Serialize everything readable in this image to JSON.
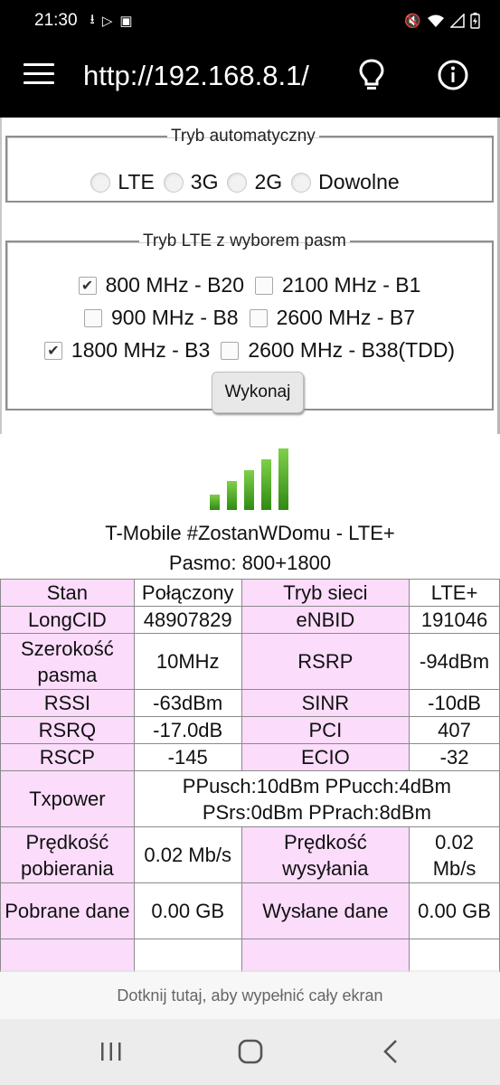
{
  "status_bar": {
    "time": "21:30",
    "left_icons": [
      "download-icon",
      "play-store-icon",
      "image-icon"
    ],
    "right_icons": [
      "mute-icon",
      "wifi-icon",
      "signal-icon",
      "battery-charging-icon"
    ]
  },
  "app_bar": {
    "url": "http://192.168.8.1/",
    "icons": [
      "menu-icon",
      "lightbulb-icon",
      "info-icon"
    ]
  },
  "auto_mode": {
    "legend": "Tryb automatyczny",
    "options": [
      "LTE",
      "3G",
      "2G",
      "Dowolne"
    ]
  },
  "band_mode": {
    "legend": "Tryb LTE z wyborem pasm",
    "bands": [
      {
        "label": "800 MHz - B20",
        "checked": true
      },
      {
        "label": "2100 MHz - B1",
        "checked": false
      },
      {
        "label": "900 MHz - B8",
        "checked": false
      },
      {
        "label": "2600 MHz - B7",
        "checked": false
      },
      {
        "label": "1800 MHz - B3",
        "checked": true
      },
      {
        "label": "2600 MHz - B38(TDD)",
        "checked": false
      }
    ],
    "execute_label": "Wykonaj"
  },
  "signal": {
    "bars_total": 5,
    "bars_lit": 5,
    "network_name": "T-Mobile #ZostanWDomu - LTE+",
    "band_line": "Pasmo: 800+1800"
  },
  "table": {
    "rows": [
      [
        "Stan",
        "Połączony",
        "Tryb sieci",
        "LTE+"
      ],
      [
        "LongCID",
        "48907829",
        "eNBID",
        "191046"
      ],
      [
        "Szerokość pasma",
        "10MHz",
        "RSRP",
        "-94dBm"
      ],
      [
        "RSSI",
        "-63dBm",
        "SINR",
        "-10dB"
      ],
      [
        "RSRQ",
        "-17.0dB",
        "PCI",
        "407"
      ],
      [
        "RSCP",
        "-145",
        "ECIO",
        "-32"
      ],
      [
        "Txpower",
        "PPusch:10dBm PPucch:4dBm PSrs:0dBm PPrach:8dBm"
      ],
      [
        "Prędkość pobierania",
        "0.02 Mb/s",
        "Prędkość wysyłania",
        "0.02 Mb/s"
      ],
      [
        "Pobrane dane",
        "0.00 GB",
        "Wysłane dane",
        "0.00 GB"
      ]
    ]
  },
  "fullscreen_hint": "Dotknij tutaj, aby wypełnić cały ekran",
  "nav_bar": {
    "icons": [
      "recents-icon",
      "home-icon",
      "back-icon"
    ]
  },
  "colors": {
    "label_cell": "#fbdcfb",
    "signal_green": "#3fa41f",
    "top_bar": "#000000"
  }
}
